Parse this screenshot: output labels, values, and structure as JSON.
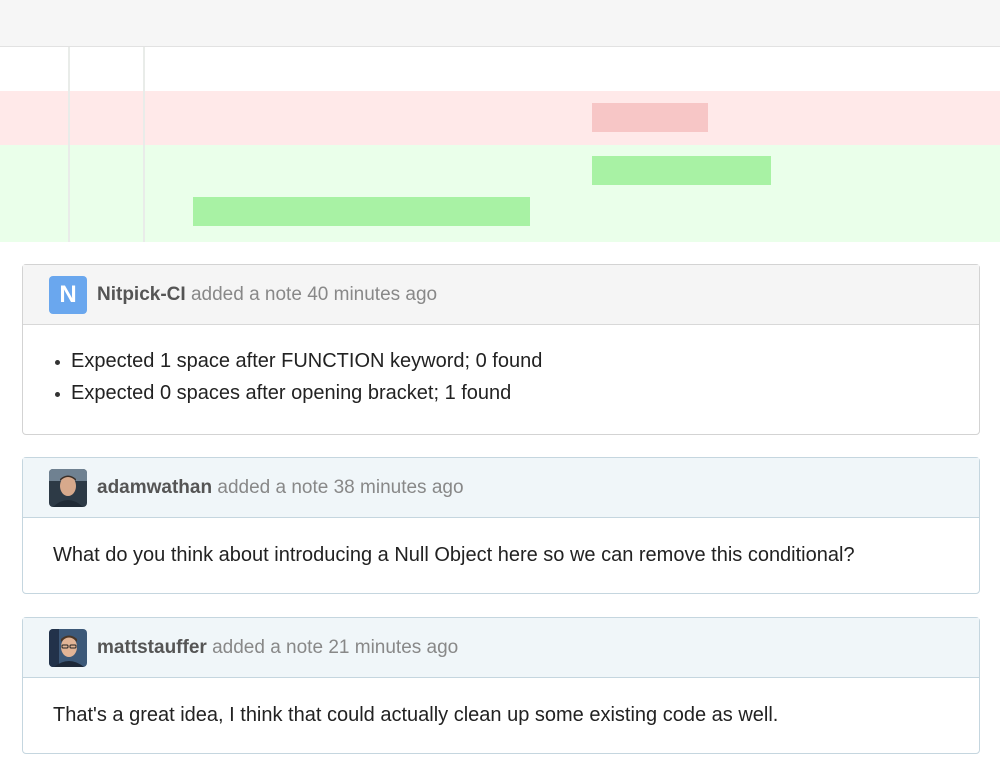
{
  "notes": [
    {
      "avatar_letter": "N",
      "author": "Nitpick-CI",
      "action": "added a note",
      "time": "40 minutes ago",
      "items": [
        "Expected 1 space after FUNCTION keyword; 0 found",
        "Expected 0 spaces after opening bracket; 1 found"
      ]
    },
    {
      "author": "adamwathan",
      "action": "added a note",
      "time": "38 minutes ago",
      "body": "What do you think about introducing a Null Object here so we can remove this conditional?"
    },
    {
      "author": "mattstauffer",
      "action": "added a note",
      "time": "21 minutes ago",
      "body": "That's a great idea, I think that could actually clean up some existing code as well."
    }
  ],
  "colors": {
    "deletion_bg": "#ffe9e9",
    "deletion_highlight": "#f7c6c6",
    "addition_bg": "#eaffea",
    "addition_highlight": "#a8f2a4",
    "bot_avatar": "#6aa7ee"
  }
}
